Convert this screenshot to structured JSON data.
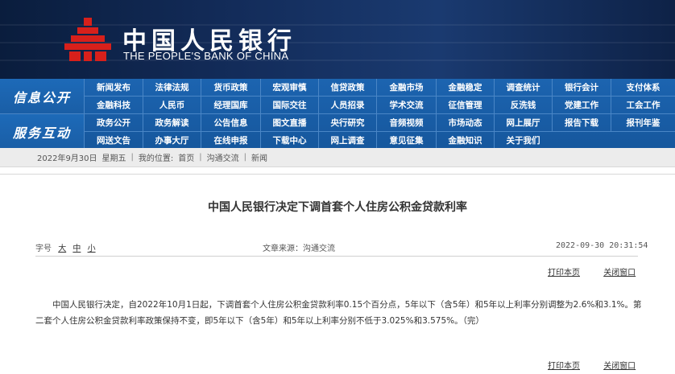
{
  "header": {
    "title_cn": "中国人民银行",
    "title_en": "THE PEOPLE'S BANK OF CHINA",
    "colors": {
      "banner": "#132c5a",
      "nav": "#1c64b0"
    }
  },
  "nav": {
    "section1_label": "信息公开",
    "section2_label": "服务互动",
    "section1_rows": [
      [
        "新闻发布",
        "法律法规",
        "货币政策",
        "宏观审慎",
        "信贷政策",
        "金融市场",
        "金融稳定",
        "调查统计",
        "银行会计",
        "支付体系"
      ],
      [
        "金融科技",
        "人民币",
        "经理国库",
        "国际交往",
        "人员招录",
        "学术交流",
        "征信管理",
        "反洗钱",
        "党建工作",
        "工会工作"
      ]
    ],
    "section2_rows": [
      [
        "政务公开",
        "政务解读",
        "公告信息",
        "图文直播",
        "央行研究",
        "音频视频",
        "市场动态",
        "网上展厅",
        "报告下载",
        "报刊年鉴"
      ],
      [
        "网送文告",
        "办事大厅",
        "在线申报",
        "下载中心",
        "网上调查",
        "意见征集",
        "金融知识",
        "关于我们"
      ]
    ]
  },
  "breadcrumb": {
    "date": "2022年9月30日",
    "weekday": "星期五",
    "location_label": "我的位置:",
    "items": [
      "首页",
      "沟通交流",
      "新闻"
    ]
  },
  "article": {
    "title": "中国人民银行决定下调首套个人住房公积金贷款利率",
    "font_size_label": "字号",
    "font_sizes": [
      "大",
      "中",
      "小"
    ],
    "source": "文章来源：沟通交流",
    "timestamp": "2022-09-30  20:31:54",
    "print_label": "打印本页",
    "close_label": "关闭窗口",
    "body": "中国人民银行决定，自2022年10月1日起，下调首套个人住房公积金贷款利率0.15个百分点，5年以下（含5年）和5年以上利率分别调整为2.6%和3.1%。第二套个人住房公积金贷款利率政策保持不变，即5年以下（含5年）和5年以上利率分别不低于3.025%和3.575%。（完）"
  }
}
